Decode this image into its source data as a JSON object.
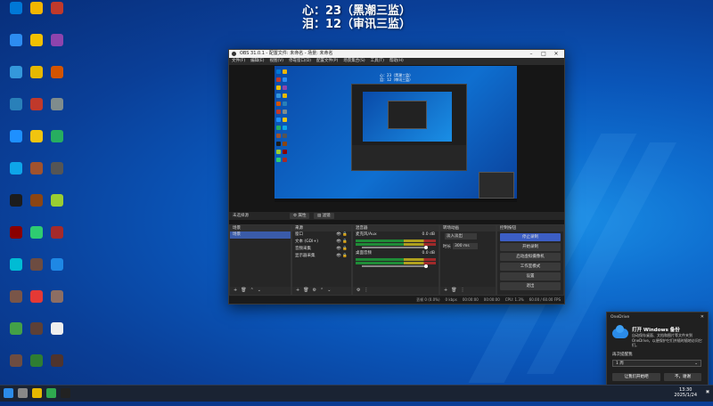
{
  "overlay": {
    "line1": "心：23（黑潮三监）",
    "line2": "泪：12（审讯三监）"
  },
  "desktop_icons": [
    {
      "label": "",
      "color": "#0078d7",
      "icon": "recycle-bin-icon"
    },
    {
      "label": "",
      "color": "#f2b600",
      "icon": "app-icon"
    },
    {
      "label": "",
      "color": "#c0392b",
      "icon": "game-icon"
    },
    {
      "label": "",
      "color": "#2d8cf0",
      "icon": "computer-icon"
    },
    {
      "label": "",
      "color": "#f0c000",
      "icon": "app-icon"
    },
    {
      "label": "",
      "color": "#8e44ad",
      "icon": "game-icon"
    },
    {
      "label": "",
      "color": "#3498db",
      "icon": "network-icon"
    },
    {
      "label": "",
      "color": "#e6b800",
      "icon": "folder-icon"
    },
    {
      "label": "",
      "color": "#d35400",
      "icon": "game-icon"
    },
    {
      "label": "",
      "color": "#2980b9",
      "icon": "control-panel-icon"
    },
    {
      "label": "",
      "color": "#c0392b",
      "icon": "archive-icon"
    },
    {
      "label": "",
      "color": "#7f8c8d",
      "icon": "app-icon"
    },
    {
      "label": "",
      "color": "#1e90ff",
      "icon": "browser-icon"
    },
    {
      "label": "",
      "color": "#f1c40f",
      "icon": "app-icon"
    },
    {
      "label": "",
      "color": "#27ae60",
      "icon": "nvidia-icon"
    },
    {
      "label": "",
      "color": "#0ea5e9",
      "icon": "edge-icon"
    },
    {
      "label": "",
      "color": "#a0522d",
      "icon": "game-icon"
    },
    {
      "label": "",
      "color": "#555",
      "icon": "app-icon"
    },
    {
      "label": "",
      "color": "#1c1c1c",
      "icon": "obs-icon"
    },
    {
      "label": "",
      "color": "#8b4513",
      "icon": "game-icon"
    },
    {
      "label": "",
      "color": "#9acd32",
      "icon": "app-icon"
    },
    {
      "label": "",
      "color": "#8b0000",
      "icon": "game-icon"
    },
    {
      "label": "",
      "color": "#2ecc71",
      "icon": "app-icon"
    },
    {
      "label": "",
      "color": "#a52a2a",
      "icon": "game-icon"
    },
    {
      "label": "",
      "color": "#00bcd4",
      "icon": "app-icon"
    },
    {
      "label": "",
      "color": "#6d4c41",
      "icon": "game-icon"
    },
    {
      "label": "",
      "color": "#1e88e5",
      "icon": "app-icon"
    },
    {
      "label": "",
      "color": "#795548",
      "icon": "game-icon"
    },
    {
      "label": "",
      "color": "#e53935",
      "icon": "app-icon"
    },
    {
      "label": "",
      "color": "#8d6e63",
      "icon": "game-icon"
    },
    {
      "label": "",
      "color": "#43a047",
      "icon": "wechat-icon"
    },
    {
      "label": "",
      "color": "#5d4037",
      "icon": "game-icon"
    },
    {
      "label": "",
      "color": "#eeeeee",
      "icon": "file-icon"
    },
    {
      "label": "",
      "color": "#6d4c41",
      "icon": "game-icon"
    },
    {
      "label": "",
      "color": "#2e7d32",
      "icon": "app-icon"
    },
    {
      "label": "",
      "color": "#4e342e",
      "icon": "game-icon"
    }
  ],
  "obs": {
    "title": "OBS 31.0.1 - 配置文件: 未命名 - 场景: 未命名",
    "menu": [
      "文件(F)",
      "编辑(E)",
      "视图(V)",
      "停靠窗口(D)",
      "配置文件(P)",
      "场景集合(S)",
      "工具(T)",
      "帮助(H)"
    ],
    "preview_small_text": [
      "23秒",
      "观看直播中"
    ],
    "context_bar": {
      "label": "未选择源",
      "properties": "属性",
      "filters": "滤镜"
    },
    "scenes": {
      "title": "场景",
      "items": [
        "场景"
      ]
    },
    "sources": {
      "title": "来源",
      "items": [
        "窗口",
        "文本 (GDI+)",
        "音频采集",
        "显示器采集"
      ]
    },
    "mixer": {
      "title": "混音器",
      "channels": [
        {
          "name": "麦克风/Aux",
          "db": "0.0 dB"
        },
        {
          "name": "桌面音频",
          "db": "0.0 dB"
        }
      ]
    },
    "transitions": {
      "title": "转场动画",
      "type": "淡入淡出",
      "duration_label": "时长",
      "duration": "300 ms"
    },
    "controls": {
      "title": "控制按钮",
      "buttons": [
        "停止录制",
        "开始录制",
        "启动虚拟摄像机",
        "工作室模式",
        "设置",
        "退出"
      ]
    },
    "status": [
      "丢帧 0 (0.0%)",
      "0 kbps",
      "00:00:00",
      "00:00:00",
      "CPU: 1.3%",
      "60.00 / 60.00 FPS"
    ]
  },
  "toast": {
    "app": "OneDrive",
    "title": "打开 Windows 备份",
    "body": "自动保存桌面、文档和图片等文件夹到 OneDrive，以便保护它们并随时随地访问它们。",
    "remind_label": "再次提醒我",
    "remind_value": "1 周",
    "primary": "让我们开始吧",
    "secondary": "不，谢谢"
  },
  "taskbar": {
    "time": "13:30",
    "date": "2025/1/24",
    "items": [
      {
        "color": "#2b8be8",
        "icon": "start-icon"
      },
      {
        "color": "#888",
        "icon": "search-icon"
      },
      {
        "color": "#e6b800",
        "icon": "explorer-icon"
      },
      {
        "color": "#2fa84f",
        "icon": "app-icon"
      },
      {
        "color": "#222",
        "icon": "obs-icon"
      }
    ]
  }
}
